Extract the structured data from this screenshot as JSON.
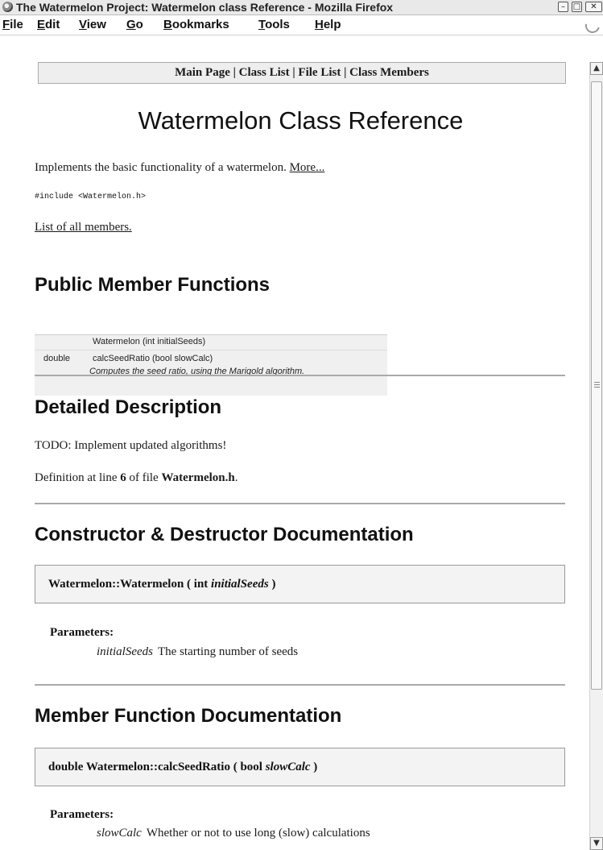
{
  "window": {
    "title": "The Watermelon Project: Watermelon class Reference - Mozilla Firefox",
    "min": "–",
    "max": "□",
    "close": "✕"
  },
  "menu": [
    {
      "u": "F",
      "rest": "ile"
    },
    {
      "u": "E",
      "rest": "dit"
    },
    {
      "u": "V",
      "rest": "iew"
    },
    {
      "u": "G",
      "rest": "o"
    },
    {
      "u": "B",
      "rest": "ookmarks"
    },
    {
      "u": "T",
      "rest": "ools"
    },
    {
      "u": "H",
      "rest": "elp"
    }
  ],
  "qindex": {
    "main_page": "Main Page",
    "class_list": "Class List",
    "file_list": "File List",
    "class_members": "Class Members",
    "sep": " | "
  },
  "page_title": "Watermelon Class Reference",
  "brief": {
    "text": "Implements the basic functionality of a watermelon.",
    "more": "More..."
  },
  "include": "#include <Watermelon.h>",
  "all_members": "List of all members.",
  "public_functions": {
    "heading": "Public Member Functions",
    "rows": [
      {
        "type": "",
        "sig": "Watermelon (int initialSeeds)"
      },
      {
        "type": "double",
        "sig": "calcSeedRatio (bool slowCalc)",
        "desc": "Computes the seed ratio, using the Marigold algorithm."
      }
    ]
  },
  "detailed": {
    "heading": "Detailed Description",
    "todo": "TODO: Implement updated algorithms!",
    "def_prefix": "Definition at line ",
    "def_line": "6",
    "def_mid": " of file ",
    "def_file": "Watermelon.h",
    "def_suffix": "."
  },
  "ctor": {
    "heading": "Constructor & Destructor Documentation",
    "proto_name": "Watermelon::Watermelon ( int ",
    "proto_param": "initialSeeds",
    "proto_end": " )",
    "params_label": "Parameters:",
    "param_name": "initialSeeds",
    "param_desc": "The starting number of seeds"
  },
  "memfunc": {
    "heading": "Member Function Documentation",
    "proto_name": "double Watermelon::calcSeedRatio ( bool ",
    "proto_param": "slowCalc",
    "proto_end": " )",
    "params_label": "Parameters:",
    "param_name": "slowCalc",
    "param_desc": "Whether or not to use long (slow) calculations"
  },
  "scrollbar": {
    "up": "▲",
    "down": "▼"
  }
}
